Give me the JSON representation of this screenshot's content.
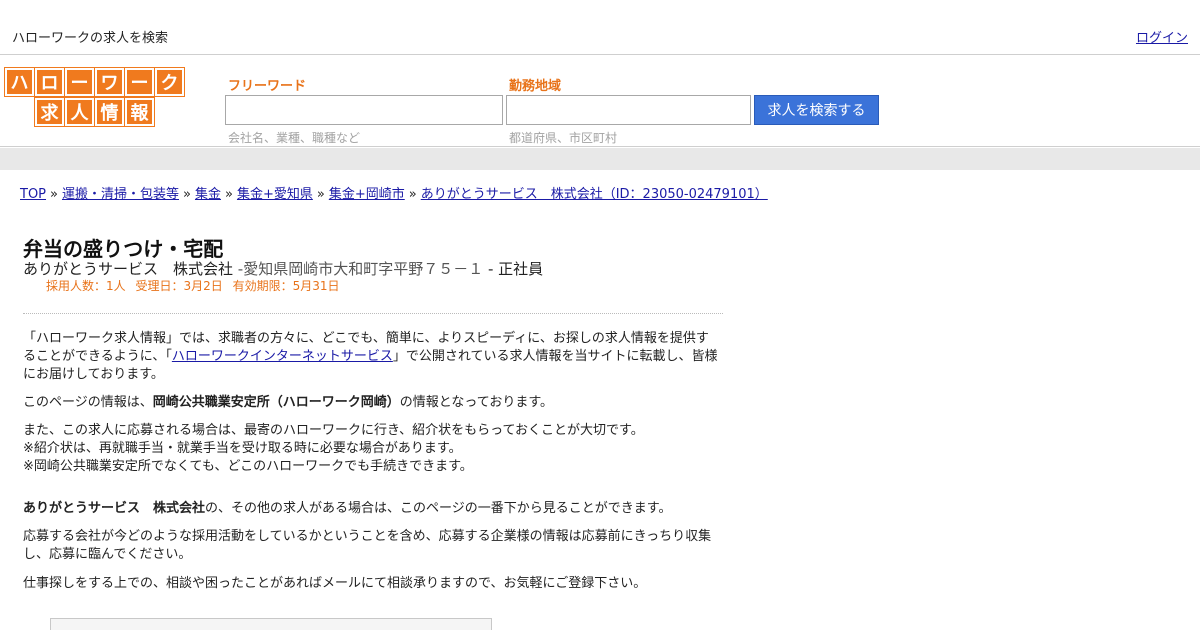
{
  "topbar": {
    "title": "ハローワークの求人を検索",
    "login": "ログイン"
  },
  "logo": {
    "row1": [
      "ハ",
      "ロ",
      "ー",
      "ワ",
      "ー",
      "ク"
    ],
    "row2": [
      "求",
      "人",
      "情",
      "報"
    ],
    "color": "#f07a1e"
  },
  "search": {
    "freeword_label": "フリーワード",
    "freeword_value": "",
    "freeword_hint": "会社名、業種、職種など",
    "area_label": "勤務地域",
    "area_value": "",
    "area_hint": "都道府県、市区町村",
    "button": "求人を検索する",
    "button_color": "#3b73d9"
  },
  "breadcrumb": [
    "TOP",
    "運搬・清掃・包装等",
    "集金",
    "集金+愛知県",
    "集金+岡崎市",
    "ありがとうサービス　株式会社（ID：23050-02479101）"
  ],
  "breadcrumb_sep": "»",
  "job": {
    "title": "弁当の盛りつけ・宅配",
    "company": "ありがとうサービス　株式会社",
    "address": " -愛知県岡崎市大和町字平野７５－１",
    "employment": " - 正社員",
    "hires": "採用人数：1人",
    "received": "受理日：3月2日",
    "expires": "有効期限：5月31日"
  },
  "content": {
    "p1_a": "「ハローワーク求人情報」では、求職者の方々に、どこでも、簡単に、よりスピーディに、お探しの求人情報を提供することができるように、「",
    "p1_link": "ハローワークインターネットサービス",
    "p1_b": "」で公開されている求人情報を当サイトに転載し、皆様にお届けしております。",
    "p2_a": "このページの情報は、",
    "p2_bold": "岡崎公共職業安定所（ハローワーク岡崎）",
    "p2_b": "の情報となっております。",
    "p3_line1": "また、この求人に応募される場合は、最寄のハローワークに行き、紹介状をもらっておくことが大切です。",
    "p3_line2": "※紹介状は、再就職手当・就業手当を受け取る時に必要な場合があります。",
    "p3_line3": "※岡崎公共職業安定所でなくても、どこのハローワークでも手続きできます。",
    "p4_bold": "ありがとうサービス　株式会社",
    "p4_b": "の、その他の求人がある場合は、このページの一番下から見ることができます。",
    "p5": "応募する会社が今どのような採用活動をしているかということを含め、応募する企業様の情報は応募前にきっちり収集し、応募に臨んでください。",
    "p6": "仕事探しをする上での、相談や困ったことがあればメールにて相談承りますので、お気軽にご登録下さい。"
  }
}
